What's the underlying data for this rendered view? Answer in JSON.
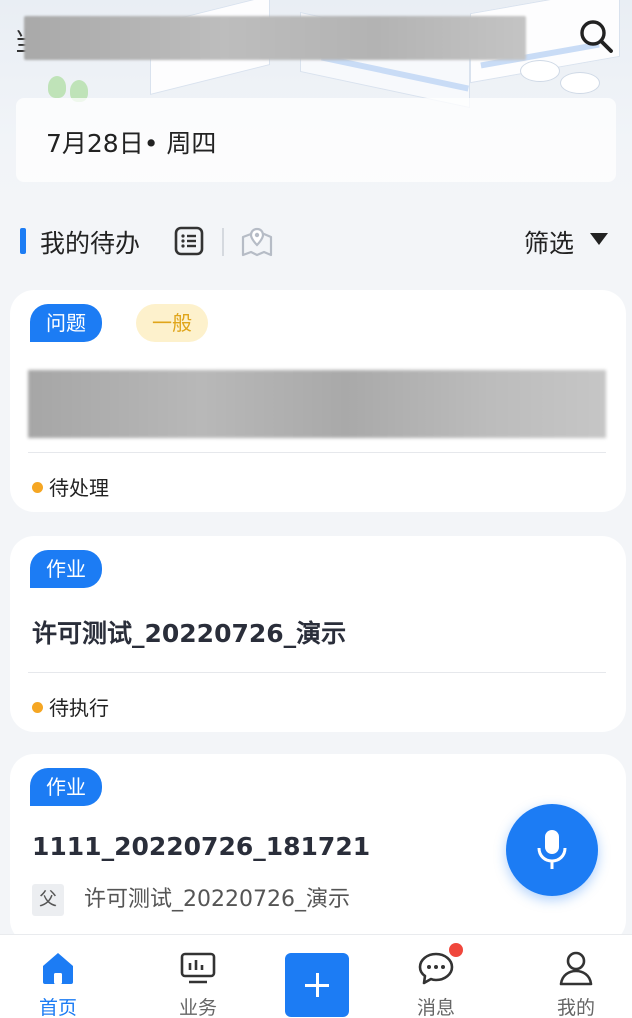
{
  "header": {
    "title_visible_char": "当",
    "date": "7月28日• 周四"
  },
  "todo": {
    "section_title": "我的待办",
    "filter_label": "筛选"
  },
  "cards": [
    {
      "type_label": "问题",
      "priority_label": "一般",
      "status": "待处理"
    },
    {
      "type_label": "作业",
      "title": "许可测试_20220726_演示",
      "status": "待执行"
    },
    {
      "type_label": "作业",
      "title": "1111_20220726_181721",
      "parent_tag": "父",
      "parent_title": "许可测试_20220726_演示"
    }
  ],
  "tabbar": {
    "home": "首页",
    "business": "业务",
    "messages": "消息",
    "mine": "我的"
  },
  "colors": {
    "accent": "#1c7cf4",
    "warning_dot": "#f5a623",
    "badge": "#f0473c",
    "priority_text": "#e0a51a",
    "priority_bg": "#fdf1cc"
  }
}
